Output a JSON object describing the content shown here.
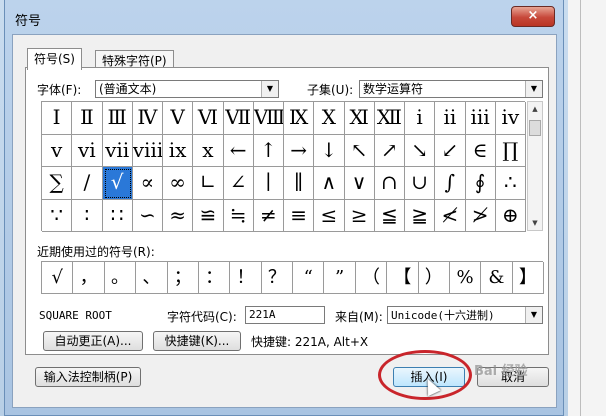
{
  "window": {
    "title": "符号",
    "close_icon": "×"
  },
  "tabs": [
    {
      "label": "符号(S)"
    },
    {
      "label": "特殊字符(P)"
    }
  ],
  "font": {
    "label": "字体(F):",
    "value": "(普通文本)"
  },
  "subset": {
    "label": "子集(U):",
    "value": "数学运算符"
  },
  "symbol_grid": {
    "rows": [
      [
        "Ⅰ",
        "Ⅱ",
        "Ⅲ",
        "Ⅳ",
        "Ⅴ",
        "Ⅵ",
        "Ⅶ",
        "Ⅷ",
        "Ⅸ",
        "Ⅹ",
        "Ⅺ",
        "Ⅻ",
        "ⅰ",
        "ⅱ",
        "ⅲ",
        "ⅳ"
      ],
      [
        "ⅴ",
        "ⅵ",
        "ⅶ",
        "ⅷ",
        "ⅸ",
        "ⅹ",
        "←",
        "↑",
        "→",
        "↓",
        "↖",
        "↗",
        "↘",
        "↙",
        "∈",
        "∏"
      ],
      [
        "∑",
        "∕",
        "√",
        "∝",
        "∞",
        "∟",
        "∠",
        "∣",
        "∥",
        "∧",
        "∨",
        "∩",
        "∪",
        "∫",
        "∮",
        "∴"
      ],
      [
        "∵",
        "∶",
        "∷",
        "∽",
        "≈",
        "≌",
        "≒",
        "≠",
        "≡",
        "≤",
        "≥",
        "≦",
        "≧",
        "≮",
        "≯",
        "⊕"
      ]
    ],
    "selected": "√"
  },
  "recent": {
    "label": "近期使用过的符号(R):",
    "symbols": [
      "√",
      "，",
      "。",
      "、",
      "；",
      "：",
      "！",
      "？",
      "“",
      "”",
      "（",
      "【",
      "）",
      "%",
      "&",
      "】"
    ]
  },
  "char_name": "SQUARE ROOT",
  "char_code": {
    "label": "字符代码(C):",
    "value": "221A"
  },
  "from": {
    "label": "来自(M):",
    "value": "Unicode(十六进制)"
  },
  "buttons": {
    "autocorrect": "自动更正(A)...",
    "shortcut": "快捷键(K)...",
    "ime_control": "输入法控制柄(P)",
    "insert": "插入(I)",
    "cancel": "取消"
  },
  "shortcut_text": "快捷键: 221A, Alt+X",
  "watermark": "Bai 经验"
}
